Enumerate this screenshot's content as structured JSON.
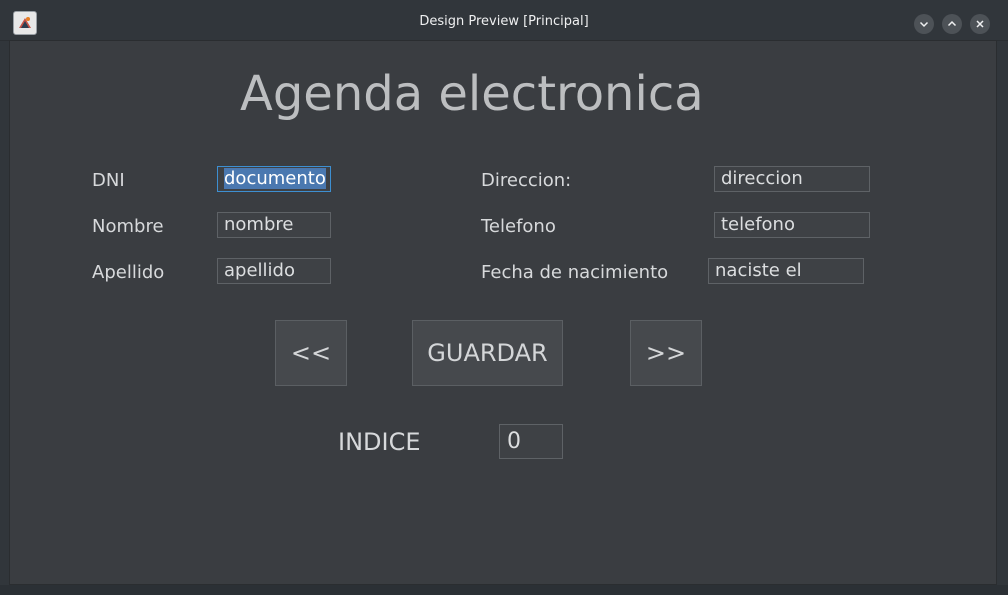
{
  "window": {
    "title": "Design Preview [Principal]",
    "controls": [
      "minimize",
      "maximize",
      "close"
    ]
  },
  "form": {
    "heading": "Agenda electronica",
    "fields": {
      "dni": {
        "label": "DNI",
        "value": "documento"
      },
      "nombre": {
        "label": "Nombre",
        "value": "nombre"
      },
      "apellido": {
        "label": "Apellido",
        "value": "apellido"
      },
      "direccion": {
        "label": "Direccion:",
        "value": "direccion"
      },
      "telefono": {
        "label": "Telefono",
        "value": "telefono"
      },
      "fecha": {
        "label": "Fecha de nacimiento",
        "value": "naciste el"
      }
    },
    "buttons": {
      "prev": "<<",
      "save": "GUARDAR",
      "next": ">>"
    },
    "indice": {
      "label": "INDICE",
      "value": "0"
    }
  },
  "colors": {
    "background": "#3a3d41",
    "titlebar": "#31363b",
    "selection": "#4a78b0",
    "focus_border": "#3d8fd1"
  }
}
